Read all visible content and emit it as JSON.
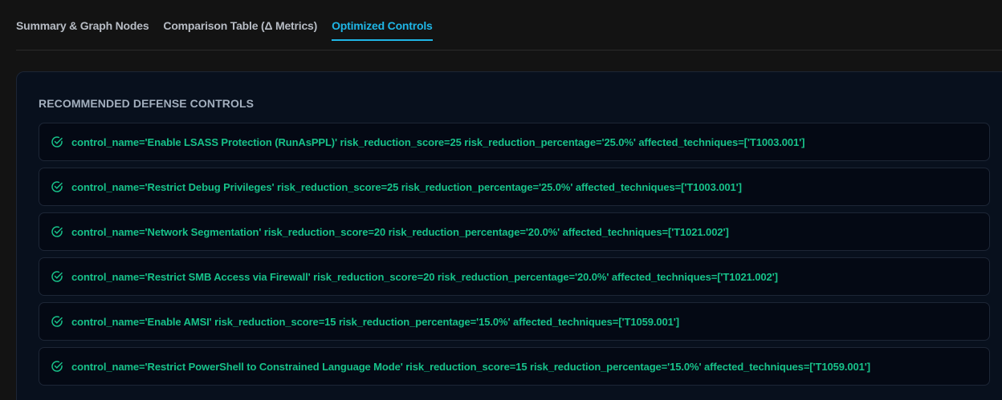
{
  "tabs": [
    {
      "label": "Summary & Graph Nodes",
      "active": false
    },
    {
      "label": "Comparison Table (Δ Metrics)",
      "active": false
    },
    {
      "label": "Optimized Controls",
      "active": true
    }
  ],
  "panel": {
    "title": "RECOMMENDED DEFENSE CONTROLS",
    "controls": [
      {
        "text": "control_name='Enable LSASS Protection (RunAsPPL)' risk_reduction_score=25 risk_reduction_percentage='25.0%' affected_techniques=['T1003.001']"
      },
      {
        "text": "control_name='Restrict Debug Privileges' risk_reduction_score=25 risk_reduction_percentage='25.0%' affected_techniques=['T1003.001']"
      },
      {
        "text": "control_name='Network Segmentation' risk_reduction_score=20 risk_reduction_percentage='20.0%' affected_techniques=['T1021.002']"
      },
      {
        "text": "control_name='Restrict SMB Access via Firewall' risk_reduction_score=20 risk_reduction_percentage='20.0%' affected_techniques=['T1021.002']"
      },
      {
        "text": "control_name='Enable AMSI' risk_reduction_score=15 risk_reduction_percentage='15.0%' affected_techniques=['T1059.001']"
      },
      {
        "text": "control_name='Restrict PowerShell to Constrained Language Mode' risk_reduction_score=15 risk_reduction_percentage='15.0%' affected_techniques=['T1059.001']"
      }
    ]
  },
  "colors": {
    "background": "#131313",
    "accent": "#1fb6e6",
    "control_text": "#17c28a",
    "panel_bg": "#08101d"
  },
  "icons": {
    "control_check": "check-circle-icon"
  }
}
